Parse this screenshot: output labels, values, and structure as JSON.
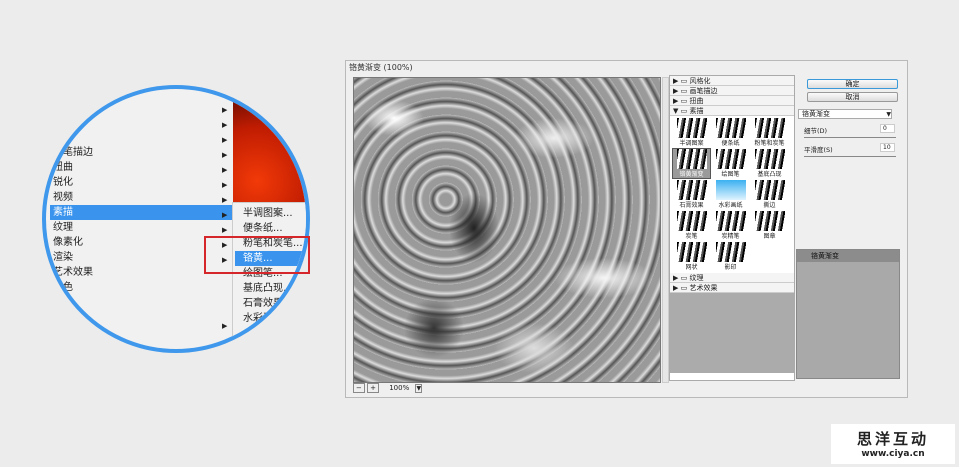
{
  "menu": {
    "items": [
      "画笔描边",
      "扭曲",
      "锐化",
      "视频",
      "素描",
      "纹理",
      "像素化",
      "渲染",
      "艺术效果",
      "杂色"
    ],
    "selected": "素描"
  },
  "submenu": {
    "items": [
      "半调图案...",
      "便条纸...",
      "粉笔和炭笔...",
      "铬黄...",
      "绘图笔...",
      "基底凸现...",
      "石膏效果...",
      "水彩画..."
    ],
    "selected": "铬黄..."
  },
  "dialog": {
    "title": "铬黄渐变 (100%)",
    "zoom": "100%",
    "categories_top": [
      "风格化",
      "画笔描边",
      "扭曲",
      "素描"
    ],
    "thumbnails": [
      "半调图案",
      "便条纸",
      "粉笔和炭笔",
      "铬黄渐变",
      "绘图笔",
      "基底凸现",
      "石膏效果",
      "水彩画纸",
      "撕边",
      "炭笔",
      "炭精笔",
      "图章",
      "网状",
      "影印"
    ],
    "selected_thumb": "铬黄渐变",
    "categories_bottom": [
      "纹理",
      "艺术效果"
    ],
    "ok": "确定",
    "cancel": "取消",
    "filter_select": "铬黄渐变",
    "detail_label": "细节(D)",
    "detail_value": "0",
    "smooth_label": "平滑度(S)",
    "smooth_value": "10",
    "layer": "铬黄渐变"
  },
  "logo": {
    "name": "思洋互动",
    "url": "www.ciya.cn"
  }
}
